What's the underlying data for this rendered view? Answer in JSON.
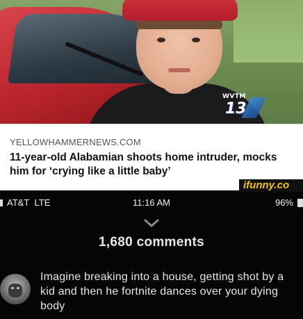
{
  "news_card": {
    "station_call": "WVTM",
    "station_number": "13",
    "domain": "YELLOWHAMMERNEWS.COM",
    "headline": "11-year-old Alabamian shoots home intruder, mocks him for ‘crying like a little baby’"
  },
  "watermark": "ifunny.co",
  "status_bar": {
    "carrier": "AT&T",
    "network": "LTE",
    "time": "11:16 AM",
    "battery": "96%"
  },
  "comments": {
    "count_label": "1,680 comments",
    "top_comment": {
      "avatar_icon": "gorilla-avatar",
      "text": "Imagine breaking into a house, getting shot by a kid and then he fortnite dances over your dying body"
    }
  },
  "colors": {
    "cap_red": "#c42634",
    "card_bg": "#ffffff",
    "phone_bg": "#050505",
    "watermark_yellow": "#f5c400",
    "station_blue": "#1a4c9c"
  }
}
